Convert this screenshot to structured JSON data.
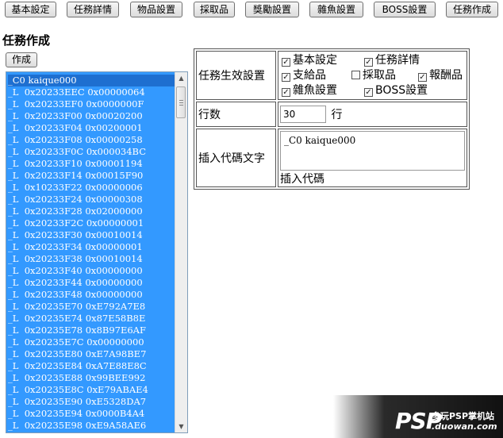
{
  "toolbar": {
    "buttons": [
      "基本設定",
      "任務詳情",
      "物品設置",
      "採取品",
      "獎勵設置",
      "雜魚設置",
      "BOSS設置",
      "任務作成"
    ]
  },
  "section": {
    "title": "任務作成",
    "create_button": "作成"
  },
  "code_lines": [
    "_C0 kaique000",
    "_L  0x20233EEC 0x00000064",
    "_L  0x20233EF0 0x0000000F",
    "_L  0x20233F00 0x00020200",
    "_L  0x20233F04 0x00200001",
    "_L  0x20233F08 0x00000258",
    "_L  0x20233F0C 0x000034BC",
    "_L  0x20233F10 0x00001194",
    "_L  0x20233F14 0x00015F90",
    "_L  0x10233F22 0x00000006",
    "_L  0x20233F24 0x00000308",
    "_L  0x20233F28 0x02000000",
    "_L  0x20233F2C 0x00000001",
    "_L  0x20233F30 0x00010014",
    "_L  0x20233F34 0x00000001",
    "_L  0x20233F38 0x00010014",
    "_L  0x20233F40 0x00000000",
    "_L  0x20233F44 0x00000000",
    "_L  0x20233F48 0x00000000",
    "_L  0x20235E70 0xE792A7E8",
    "_L  0x20235E74 0x87E58B8E",
    "_L  0x20235E78 0x8B97E6AF",
    "_L  0x20235E7C 0x00000000",
    "_L  0x20235E80 0xE7A98BE7",
    "_L  0x20235E84 0xA7E88E8C",
    "_L  0x20235E88 0x99BEE992",
    "_L  0x20235E8C 0xE79ABAE4",
    "_L  0x20235E90 0xE5328DA7",
    "_L  0x20235E94 0x0000B4A4",
    "_L  0x20235E98 0xE9A58AE6"
  ],
  "settings": {
    "effect_label": "任務生效設置",
    "checkboxes": [
      {
        "label": "基本設定",
        "checked": true,
        "mark": "✓"
      },
      {
        "label": "任務詳情",
        "checked": true,
        "mark": "✓"
      },
      {
        "label": "支給品",
        "checked": true,
        "mark": "✓"
      },
      {
        "label": "採取品",
        "checked": false,
        "mark": ""
      },
      {
        "label": "報酬品",
        "checked": true,
        "mark": "✓"
      },
      {
        "label": "雜魚設置",
        "checked": true,
        "mark": "✓"
      },
      {
        "label": "BOSS設置",
        "checked": true,
        "mark": "✓"
      }
    ],
    "lines_label": "行数",
    "lines_value": "30",
    "lines_unit": "行",
    "insert_label": "插入代碼文字",
    "insert_value": "_C0 kaique000",
    "insert_caption": "插入代碼"
  },
  "watermark": {
    "logo": "PSP",
    "name": "多玩PSP掌机站",
    "url": ".duowan.com"
  }
}
